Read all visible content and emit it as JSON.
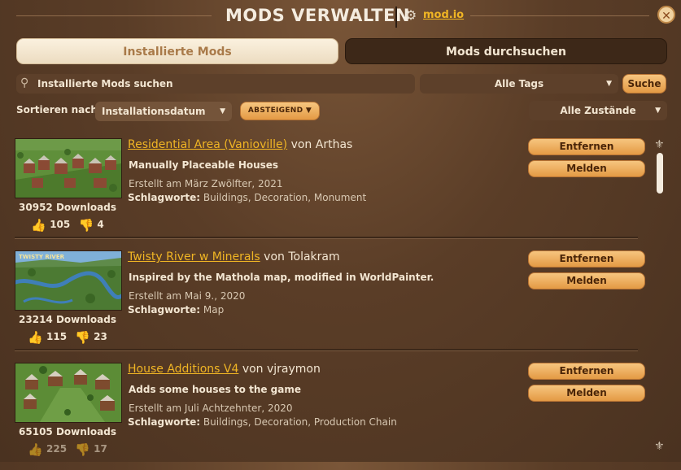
{
  "header": {
    "title": "MODS VERWALTEN",
    "link_label": "mod.io",
    "close_glyph": "✕"
  },
  "tabs": [
    {
      "label": "Installierte Mods",
      "active": true
    },
    {
      "label": "Mods durchsuchen",
      "active": false
    }
  ],
  "search": {
    "placeholder": "Installierte Mods suchen",
    "value": "",
    "tags_selected": "Alle Tags",
    "button_label": "Suche"
  },
  "sort": {
    "label": "Sortieren nach",
    "selected": "Installationsdatum",
    "order_label": "ABSTEIGEND",
    "state_selected": "Alle Zustände"
  },
  "mods": [
    {
      "name": "Residential Area (Vanioville)",
      "by": "von Arthas",
      "description": "Manually Placeable Houses",
      "created": "Erstellt am März Zwölfter, 2021",
      "tags_label": "Schlagworte:",
      "tags": "Buildings, Decoration, Monument",
      "downloads": "30952 Downloads",
      "likes": "105",
      "dislikes": "4",
      "remove_label": "Entfernen",
      "report_label": "Melden"
    },
    {
      "name": "Twisty River w Minerals",
      "by": "von Tolakram",
      "description": "Inspired by the Mathola map, modified in WorldPainter.",
      "created": "Erstellt am Mai 9., 2020",
      "tags_label": "Schlagworte:",
      "tags": "Map",
      "downloads": "23214 Downloads",
      "likes": "115",
      "dislikes": "23",
      "thumb_caption": "TWISTY RIVER",
      "remove_label": "Entfernen",
      "report_label": "Melden"
    },
    {
      "name": "House Additions V4",
      "by": "von vjraymon",
      "description": "Adds some houses to the game",
      "created": "Erstellt am Juli Achtzehnter, 2020",
      "tags_label": "Schlagworte:",
      "tags": "Buildings, Decoration, Production Chain",
      "downloads": "65105 Downloads",
      "likes": "225",
      "dislikes": "17",
      "remove_label": "Entfernen",
      "report_label": "Melden"
    }
  ],
  "icons": {
    "thumbs_up": "👍",
    "thumbs_down": "👎",
    "gear": "⚙",
    "search": "🔍",
    "scroll_ornament": "⚜"
  }
}
